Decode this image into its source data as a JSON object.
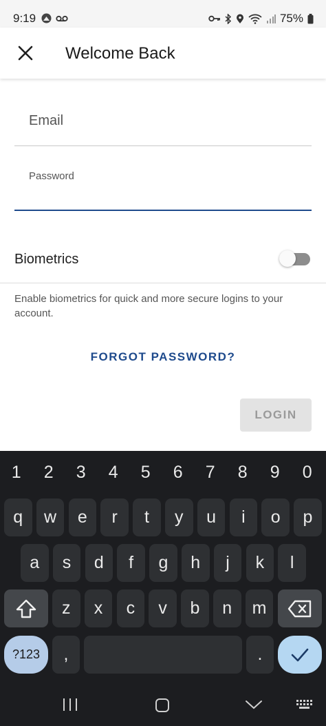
{
  "status_bar": {
    "time": "9:19",
    "battery": "75%",
    "icons": [
      "notification-app-icon",
      "voicemail-icon",
      "key-icon",
      "bluetooth-icon",
      "location-icon",
      "wifi-icon",
      "signal-icon",
      "battery-icon"
    ]
  },
  "header": {
    "title": "Welcome Back",
    "close_icon": "close-icon"
  },
  "form": {
    "email_label": "Email",
    "password_label": "Password",
    "biometrics_label": "Biometrics",
    "biometrics_enabled": false,
    "biometrics_help": "Enable biometrics for quick and more secure logins to your account.",
    "forgot_password": "FORGOT PASSWORD?",
    "login_label": "LOGIN"
  },
  "keyboard": {
    "numbers": [
      "1",
      "2",
      "3",
      "4",
      "5",
      "6",
      "7",
      "8",
      "9",
      "0"
    ],
    "row1": [
      "q",
      "w",
      "e",
      "r",
      "t",
      "y",
      "u",
      "i",
      "o",
      "p"
    ],
    "row2": [
      "a",
      "s",
      "d",
      "f",
      "g",
      "h",
      "j",
      "k",
      "l"
    ],
    "row3": [
      "z",
      "x",
      "c",
      "v",
      "b",
      "n",
      "m"
    ],
    "symbols_label": "?123",
    "comma": ",",
    "period": ".",
    "shift_icon": "shift-icon",
    "backspace_icon": "backspace-icon",
    "enter_icon": "checkmark-icon"
  },
  "nav_bar": {
    "icons": [
      "recent-apps-icon",
      "home-icon",
      "back-icon",
      "keyboard-icon"
    ]
  },
  "colors": {
    "accent": "#1e4a8c",
    "keyboard_bg": "#1c1d20",
    "key_bg": "#2e3033",
    "enter_bg": "#b5d7f2"
  }
}
